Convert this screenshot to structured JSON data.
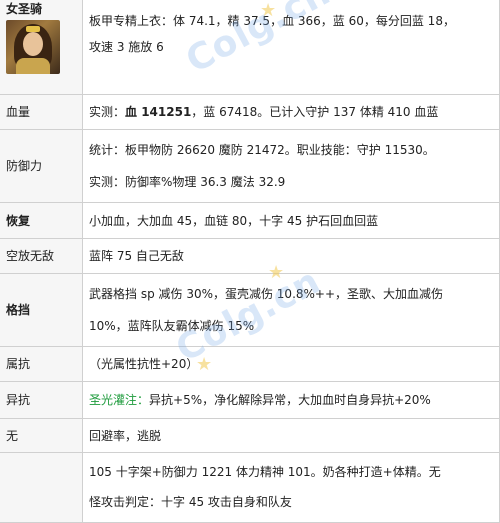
{
  "hero": {
    "name": "女圣骑",
    "stats_line1": "板甲专精上衣：体 74.1，精 37.5，血 366，蓝 60，每分回蓝 18，",
    "stats_line2": "攻速 3 施放 6"
  },
  "rows": {
    "hp": {
      "label": "血量",
      "prefix": "实测：",
      "hp_value": "血 141251",
      "suffix": "，蓝 67418。已计入守护 137 体精 410 血蓝"
    },
    "defense": {
      "label": "防御力",
      "line1": "统计：板甲物防 26620 魔防 21472。职业技能：守护 11530。",
      "line2": "实测：防御率%物理 36.3 魔法 32.9"
    },
    "recovery": {
      "label": "恢复",
      "text": "小加血，大加血 45，血链 80，十字 45 护石回血回蓝"
    },
    "invincible": {
      "label": "空放无敌",
      "text": "蓝阵 75 自己无敌"
    },
    "block": {
      "label": "格挡",
      "line1": "武器格挡 sp 减伤 30%，蛋壳减伤 10.8%++，圣歌、大加血减伤",
      "line2": "10%，蓝阵队友霸体减伤 15%"
    },
    "resist": {
      "label": "属抗",
      "text": "（光属性抗性+20）"
    },
    "status_resist": {
      "label": "异抗",
      "skill": "圣光灌注：",
      "text": "异抗+5%，净化解除异常，大加血时自身异抗+20%"
    },
    "none": {
      "label": "无",
      "text": "回避率，逃脱"
    },
    "last": {
      "label": "",
      "line1": "105 十字架+防御力 1221 体力精神 101。奶各种打造+体精。无",
      "line2": "怪攻击判定：十字 45 攻击自身和队友"
    }
  },
  "watermark": {
    "text": "Colg.cn",
    "color": "#78aae6"
  },
  "colors": {
    "label_bg": "#f6f6f6",
    "border": "#d0d0d0",
    "green": "#1e9b3c",
    "text": "#222222"
  }
}
